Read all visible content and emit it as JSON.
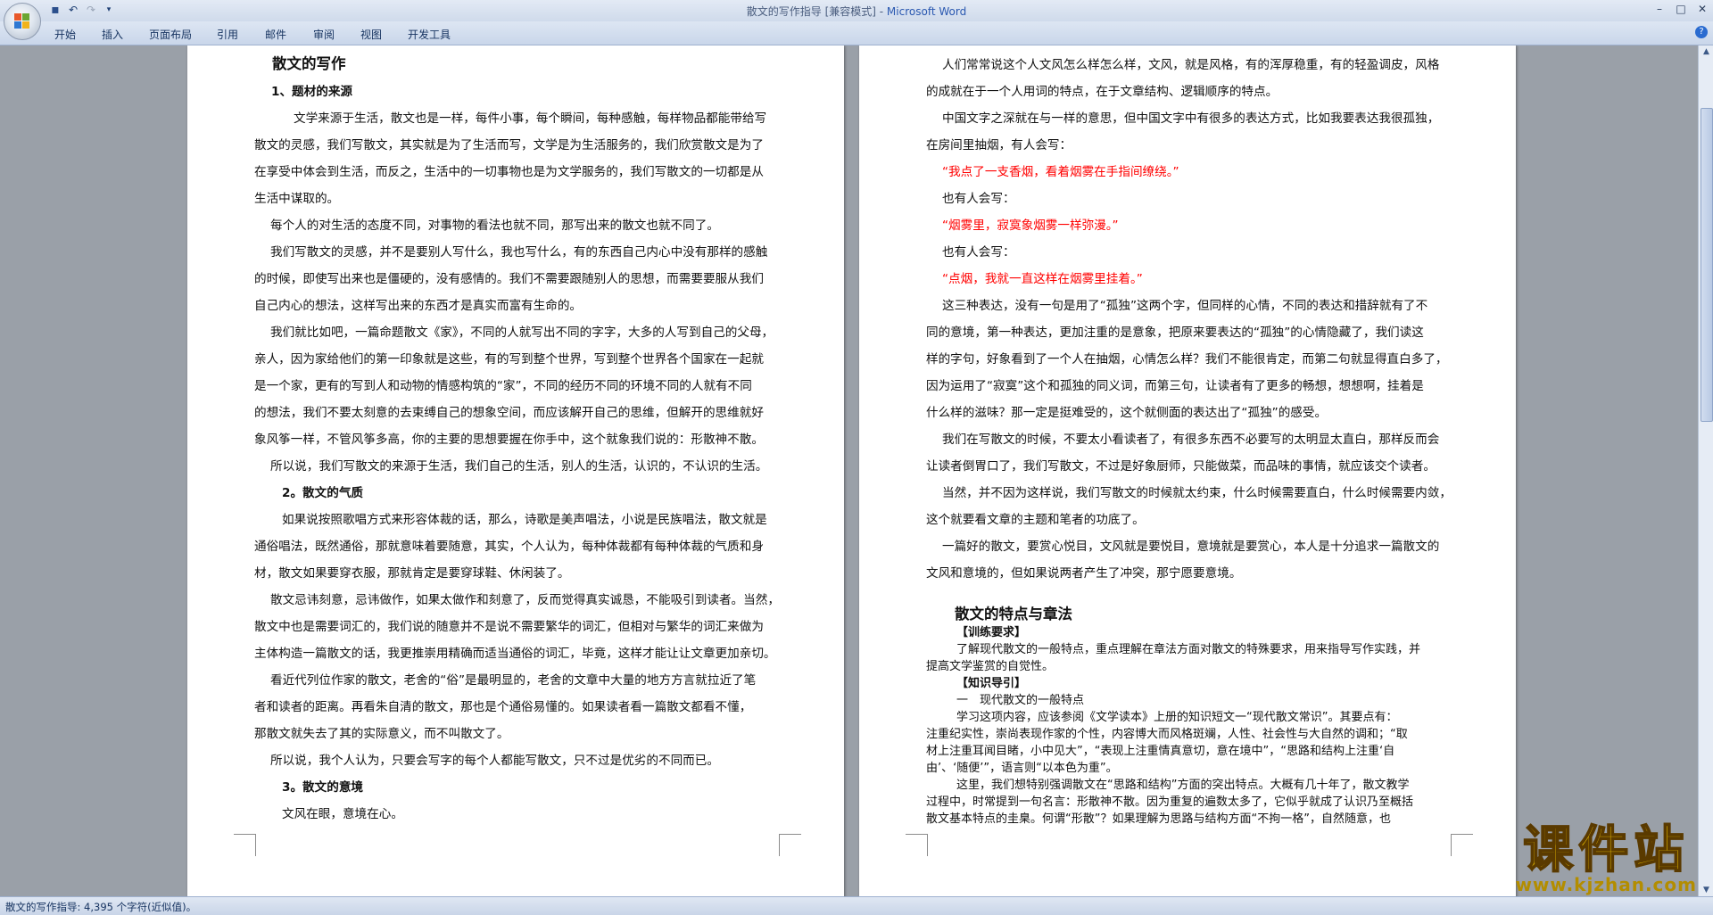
{
  "window": {
    "doc_title": "散文的写作指导 [兼容模式] - ",
    "app_name": "Microsoft Word",
    "minimize": "–",
    "maximize": "□",
    "close": "✕"
  },
  "qat": {
    "save": "▪",
    "undo": "↶",
    "redo": "↷",
    "customize": "▾"
  },
  "menu": [
    "开始",
    "插入",
    "页面布局",
    "引用",
    "邮件",
    "审阅",
    "视图",
    "开发工具"
  ],
  "help": "?",
  "page1": {
    "title": "散文的写作",
    "lines": [
      "1、题材的来源",
      "文学来源于生活，散文也是一样，每件小事，每个瞬间，每种感触，每样物品都能带给写",
      "散文的灵感，我们写散文，其实就是为了生活而写，文学是为生活服务的，我们欣赏散文是为了",
      "在享受中体会到生活，而反之，生活中的一切事物也是为文学服务的，我们写散文的一切都是从",
      "生活中谋取的。",
      "每个人的对生活的态度不同，对事物的看法也就不同，那写出来的散文也就不同了。",
      "我们写散文的灵感，并不是要别人写什么，我也写什么，有的东西自己内心中没有那样的感触",
      "的时候，即使写出来也是僵硬的，没有感情的。我们不需要跟随别人的思想，而需要要服从我们",
      "自己内心的想法，这样写出来的东西才是真实而富有生命的。",
      "我们就比如吧，一篇命题散文《家》，不同的人就写出不同的字字，大多的人写到自己的父母，",
      "亲人，因为家给他们的第一印象就是这些，有的写到整个世界，写到整个世界各个国家在一起就",
      "是一个家，更有的写到人和动物的情感构筑的“家”，不同的经历不同的环境不同的人就有不同",
      "的想法，我们不要太刻意的去束缚自己的想象空间，而应该解开自己的思维，但解开的思维就好",
      "象风筝一样，不管风筝多高，你的主要的思想要握在你手中，这个就象我们说的：形散神不散。",
      "所以说，我们写散文的来源于生活，我们自己的生活，别人的生活，认识的，不认识的生活。",
      "2。散文的气质",
      "如果说按照歌唱方式来形容体裁的话，那么，诗歌是美声唱法，小说是民族唱法，散文就是",
      "通俗唱法，既然通俗，那就意味着要随意，其实，个人认为，每种体裁都有每种体裁的气质和身",
      "材，散文如果要穿衣服，那就肯定是要穿球鞋、休闲装了。",
      "散文忌讳刻意，忌讳做作，如果太做作和刻意了，反而觉得真实诚恳，不能吸引到读者。当然，",
      "散文中也是需要词汇的，我们说的随意并不是说不需要繁华的词汇，但相对与繁华的词汇来做为",
      "主体构造一篇散文的话，我更推崇用精确而适当通俗的词汇，毕竟，这样才能让让文章更加亲切。",
      "看近代列位作家的散文，老舍的“俗”是最明显的，老舍的文章中大量的地方方言就拉近了笔",
      "者和读者的距离。再看朱自清的散文，那也是个通俗易懂的。如果读者看一篇散文都看不懂，",
      "那散文就失去了其的实际意义，而不叫散文了。",
      "所以说，我个人认为，只要会写字的每个人都能写散文，只不过是优劣的不同而已。",
      "3。散文的意境",
      "文风在眼，意境在心。"
    ]
  },
  "page2": {
    "lines": [
      "人们常常说这个人文风怎么样怎么样，文风，就是风格，有的浑厚稳重，有的轻盈调皮，风格",
      "的成就在于一个人用词的特点，在于文章结构、逻辑顺序的特点。",
      "中国文字之深就在与一样的意思，但中国文字中有很多的表达方式，比如我要表达我很孤独，",
      "在房间里抽烟，有人会写：",
      "“我点了一支香烟，看着烟雾在手指间缭绕。”",
      "也有人会写：",
      "“烟雾里，寂寞象烟雾一样弥漫。”",
      "也有人会写：",
      "“点烟，我就一直这样在烟雾里挂着。”",
      "这三种表达，没有一句是用了“孤独”这两个字，但同样的心情，不同的表达和措辞就有了不",
      "同的意境，第一种表达，更加注重的是意象，把原来要表达的“孤独”的心情隐藏了，我们读这",
      "样的字句，好象看到了一个人在抽烟，心情怎么样？我们不能很肯定，而第二句就显得直白多了，",
      "因为运用了“寂寞”这个和孤独的同义词，而第三句，让读者有了更多的畅想，想想啊，挂着是",
      "什么样的滋味？那一定是挺难受的，这个就侧面的表达出了“孤独”的感受。",
      "我们在写散文的时候，不要太小看读者了，有很多东西不必要写的太明显太直白，那样反而会",
      "让读者倒胃口了，我们写散文，不过是好象厨师，只能做菜，而品味的事情，就应该交个读者。",
      "当然，并不因为这样说，我们写散文的时候就太约束，什么时候需要直白，什么时候需要内敛，",
      "这个就要看文章的主题和笔者的功底了。",
      "一篇好的散文，要赏心悦目，文风就是要悦目，意境就是要赏心，本人是十分追求一篇散文的",
      "文风和意境的，但如果说两者产生了冲突，那宁愿要意境。",
      "",
      "散文的特点与章法",
      "【训练要求】",
      "了解现代散文的一般特点，重点理解在章法方面对散文的特殊要求，用来指导写作实践，并",
      "提高文学鉴赏的自觉性。",
      "【知识导引】",
      "一　现代散文的一般特点",
      "学习这项内容，应该参阅《文学读本》上册的知识短文一“现代散文常识”。其要点有：",
      "注重纪实性，崇尚表现作家的个性，内容博大而风格斑斓，人性、社会性与大自然的调和；“取",
      "材上注重耳闻目睹，小中见大”，“表现上注重情真意切，意在境中”，“思路和结构上注重‘自",
      "由’、‘随便’”，语言则“以本色为重”。",
      "这里，我们想特别强调散文在“思路和结构”方面的突出特点。大概有几十年了，散文教学",
      "过程中，时常提到一句名言：形散神不散。因为重复的遍数太多了，它似乎就成了认识乃至概括",
      "散文基本特点的圭臬。何谓“形散”？如果理解为思路与结构方面“不拘一格”，自然随意，也"
    ]
  },
  "status": {
    "text": "散文的写作指导: 4,395 个字符(近似值)。"
  },
  "watermark": {
    "title": "课件站",
    "url": "www.kjzhan.com"
  },
  "colors": {
    "ribbon": "#d3deef",
    "workspace": "#9aa0a8",
    "red_text": "#ff0000",
    "watermark": "#f2c500"
  }
}
